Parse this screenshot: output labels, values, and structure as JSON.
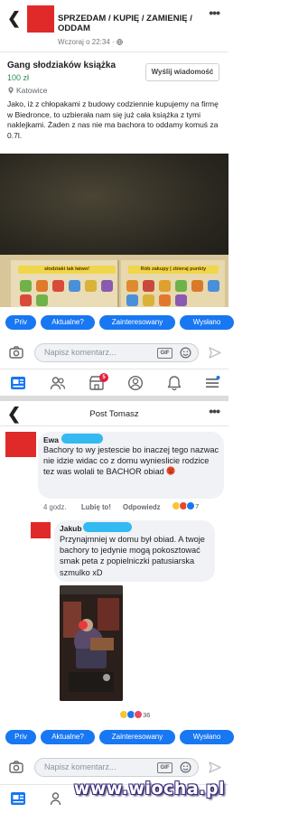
{
  "post": {
    "group_name": "SPRZEDAM / KUPIĘ / ZAMIENIĘ / ODDAM",
    "timestamp": "Wczoraj o 22:34 · ",
    "item_title": "Gang słodziaków książka",
    "price": "100 zł",
    "location": "Katowice",
    "send_message": "Wyślij wiadomość",
    "body": "Jako, iż z chłopakami z budowy codziennie kupujemy na firmę w Biedronce, to uzbierała nam się już cała książka z tymi naklejkami. Żaden z nas nie ma bachora to oddamy komuś za 0.7l.",
    "photo_banner_left": "słodziaki tak łatwo!",
    "photo_banner_right": "Rób zakupy | zbieraj punkty"
  },
  "quick_replies_1": [
    "Priv",
    "Aktualne?",
    "Zainteresowany",
    "Wysłano"
  ],
  "quick_replies_2": [
    "Priv",
    "Aktualne?",
    "Zainteresowany",
    "Wysłano"
  ],
  "composer": {
    "placeholder": "Napisz komentarz...",
    "gif_label": "GIF"
  },
  "tabbar": {
    "badge_count": "5"
  },
  "thread": {
    "title": "Post Tomasz",
    "comment1": {
      "author": "Ewa",
      "text": "Bachory to wy jestescie bo inaczej tego nazwac nie idzie widac co z domu wynieslicie rodzice tez was wolali te BACHOR obiad",
      "time": "4 godz.",
      "like": "Lubię to!",
      "reply": "Odpowiedz",
      "reaction_count": "7"
    },
    "comment2": {
      "author": "Jakub",
      "text": "Przynajmniej w domu był obiad. A twoje bachory to jedynie mogą pokosztować smak peta z popielniczki patusiarska szmulko xD",
      "reaction_count": "36"
    }
  },
  "watermark": "www.wiocha.pl",
  "colors": {
    "accent_blue": "#1877f2",
    "avatar_red": "#e02a2a",
    "redaction_blue": "#34b9f0"
  }
}
